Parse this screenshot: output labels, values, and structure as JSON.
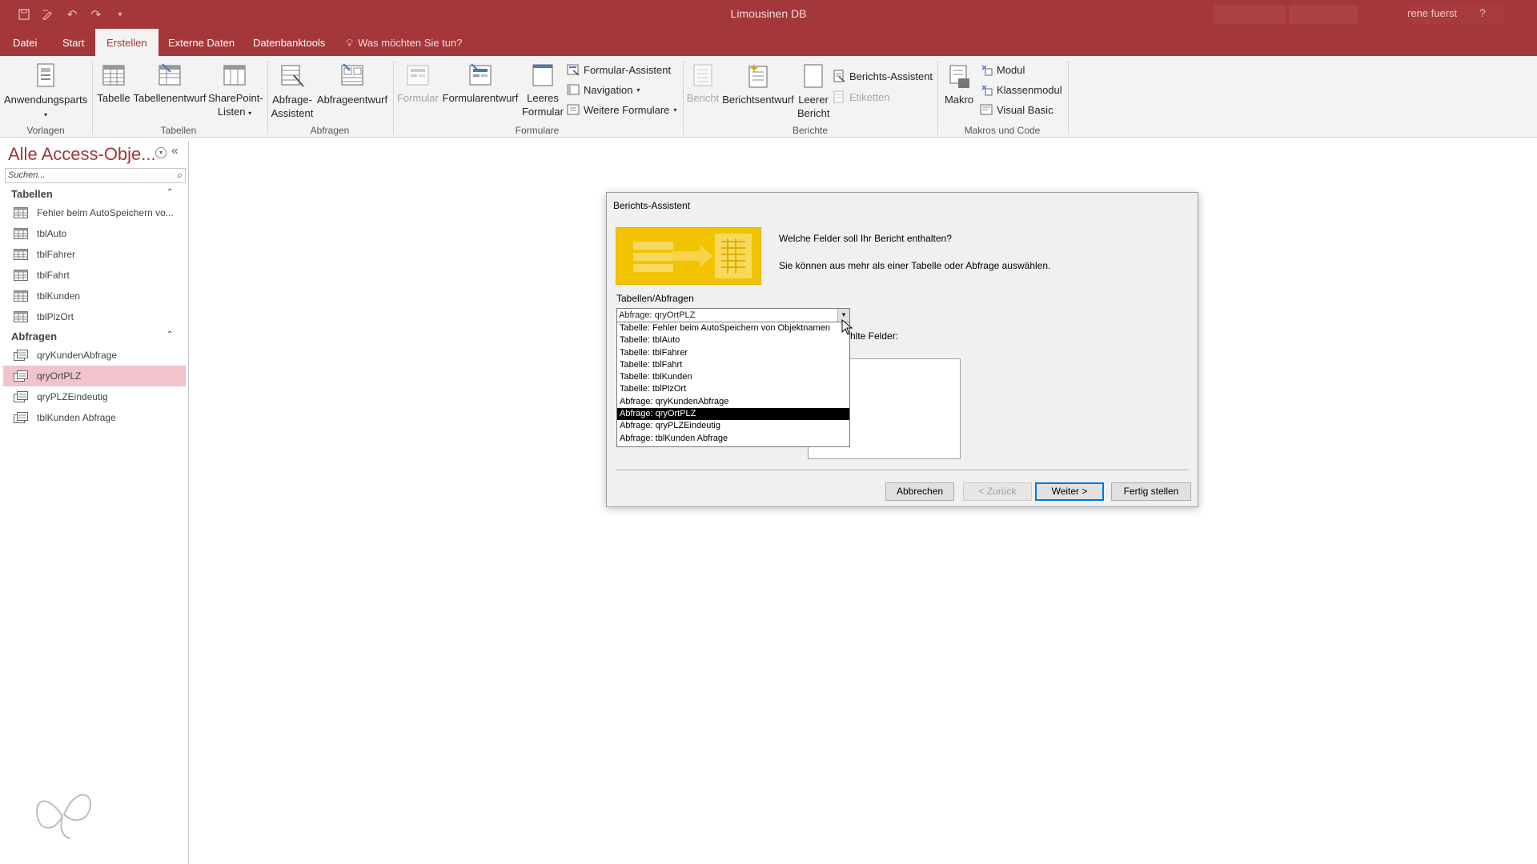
{
  "app": {
    "title": "Limousinen DB",
    "user": "rene fuerst",
    "help": "?"
  },
  "tabs": [
    {
      "label": "Datei"
    },
    {
      "label": "Start"
    },
    {
      "label": "Erstellen"
    },
    {
      "label": "Externe Daten"
    },
    {
      "label": "Datenbanktools"
    }
  ],
  "tellme": "Was möchten Sie tun?",
  "ribbon": {
    "vorlagen": {
      "group": "Vorlagen",
      "anwendungsparts": "Anwendungsparts"
    },
    "tabellen": {
      "group": "Tabellen",
      "tabelle": "Tabelle",
      "tabellenentwurf": "Tabellenentwurf",
      "sharepoint1": "SharePoint-",
      "sharepoint2": "Listen"
    },
    "abfragen": {
      "group": "Abfragen",
      "assistent1": "Abfrage-",
      "assistent2": "Assistent",
      "entwurf": "Abfrageentwurf"
    },
    "formulare": {
      "group": "Formulare",
      "formular": "Formular",
      "formularentwurf": "Formularentwurf",
      "leeres1": "Leeres",
      "leeres2": "Formular",
      "assistent": "Formular-Assistent",
      "navigation": "Navigation",
      "weitere": "Weitere Formulare"
    },
    "berichte": {
      "group": "Berichte",
      "bericht": "Bericht",
      "berichtsentwurf": "Berichtsentwurf",
      "leerer1": "Leerer",
      "leerer2": "Bericht",
      "assistent": "Berichts-Assistent",
      "etiketten": "Etiketten"
    },
    "makros": {
      "group": "Makros und Code",
      "makro": "Makro",
      "modul": "Modul",
      "klassenmodul": "Klassenmodul",
      "vb": "Visual Basic"
    }
  },
  "nav": {
    "title": "Alle Access-Obje...",
    "search_placeholder": "Suchen...",
    "sections": [
      {
        "label": "Tabellen",
        "items": [
          "Fehler beim AutoSpeichern vo...",
          "tblAuto",
          "tblFahrer",
          "tblFahrt",
          "tblKunden",
          "tblPlzOrt"
        ]
      },
      {
        "label": "Abfragen",
        "items": [
          "qryKundenAbfrage",
          "qryOrtPLZ",
          "qryPLZEindeutig",
          "tblKunden Abfrage"
        ]
      }
    ]
  },
  "dialog": {
    "title": "Berichts-Assistent",
    "question": "Welche Felder soll Ihr Bericht enthalten?",
    "hint": "Sie können aus mehr als einer Tabelle oder Abfrage auswählen.",
    "tables_label": "Tabellen/Abfragen",
    "combo_value": "Abfrage: qryOrtPLZ",
    "fields_label_partial": "hlte Felder:",
    "dropdown_items": [
      "Tabelle: Fehler beim AutoSpeichern von Objektnamen",
      "Tabelle: tblAuto",
      "Tabelle: tblFahrer",
      "Tabelle: tblFahrt",
      "Tabelle: tblKunden",
      "Tabelle: tblPlzOrt",
      "Abfrage: qryKundenAbfrage",
      "Abfrage: qryOrtPLZ",
      "Abfrage: qryPLZEindeutig",
      "Abfrage: tblKunden Abfrage"
    ],
    "selected_index": 7,
    "buttons": {
      "cancel": "Abbrechen",
      "back": "< Zurück",
      "next": "Weiter >",
      "finish": "Fertig stellen"
    }
  },
  "colors": {
    "accent": "#a4373a",
    "selected_nav": "#f1c4cc",
    "ribbon_bg": "#f3f3f3"
  }
}
